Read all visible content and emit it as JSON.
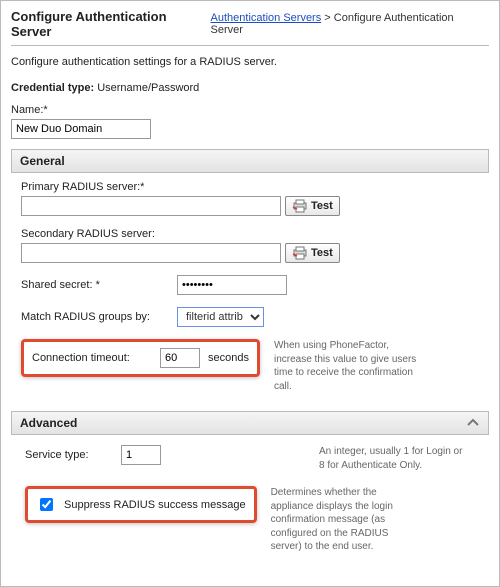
{
  "header": {
    "title": "Configure Authentication Server",
    "breadcrumb_link": "Authentication Servers",
    "breadcrumb_sep": " > ",
    "breadcrumb_current": "Configure Authentication Server"
  },
  "intro": "Configure authentication settings for a RADIUS server.",
  "credential": {
    "label": "Credential type:",
    "value": "Username/Password"
  },
  "name": {
    "label": "Name:*",
    "value": "New Duo Domain"
  },
  "sections": {
    "general": {
      "title": "General",
      "primary_label": "Primary RADIUS server:*",
      "primary_value": "",
      "secondary_label": "Secondary RADIUS server:",
      "secondary_value": "",
      "test_label": "Test",
      "secret_label": "Shared secret: *",
      "secret_value": "••••••••",
      "match_label": "Match RADIUS groups by:",
      "match_value": "filterid attrib",
      "timeout_label": "Connection timeout:",
      "timeout_value": "60",
      "timeout_unit": "seconds",
      "timeout_note": "When using PhoneFactor, increase this value to give users time to receive the confirmation call."
    },
    "advanced": {
      "title": "Advanced",
      "service_label": "Service type:",
      "service_value": "1",
      "service_note": "An integer, usually 1 for Login or 8 for Authenticate Only.",
      "suppress_label": "Suppress RADIUS success message",
      "suppress_checked": true,
      "suppress_note": "Determines whether the appliance displays the login confirmation message (as configured on the RADIUS server) to the end user."
    }
  }
}
